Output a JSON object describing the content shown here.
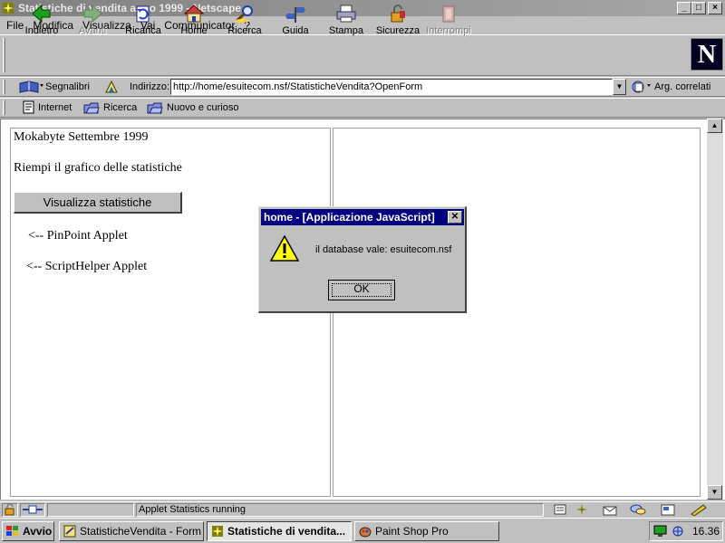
{
  "window": {
    "title": "Statistiche di vendita anno 1999 - Netscape",
    "min": "_",
    "max": "□",
    "close": "×"
  },
  "menu": [
    "File",
    "Modifica",
    "Visualizza",
    "Vai",
    "Communicator",
    "?"
  ],
  "toolbar": {
    "buttons": [
      {
        "label": "Indietro",
        "icon": "back-arrow-icon",
        "enabled": true
      },
      {
        "label": "Avanti",
        "icon": "forward-arrow-icon",
        "enabled": false
      },
      {
        "label": "Ricarica",
        "icon": "reload-icon",
        "enabled": true
      },
      {
        "label": "Home",
        "icon": "home-icon",
        "enabled": true
      },
      {
        "label": "Ricerca",
        "icon": "search-icon",
        "enabled": true
      },
      {
        "label": "Guida",
        "icon": "guide-icon",
        "enabled": true
      },
      {
        "label": "Stampa",
        "icon": "printer-icon",
        "enabled": true
      },
      {
        "label": "Sicurezza",
        "icon": "padlock-icon",
        "enabled": true
      },
      {
        "label": "Interrompi",
        "icon": "stop-icon",
        "enabled": false
      }
    ],
    "logo": "N"
  },
  "location": {
    "bookmarks_label": "Segnalibri",
    "address_label": "Indirizzo:",
    "url": "http://home/esuitecom.nsf/StatisticheVendita?OpenForm",
    "related_label": "Arg. correlati"
  },
  "personal": [
    "Internet",
    "Ricerca",
    "Nuovo e curioso"
  ],
  "page": {
    "heading": "Mokabyte Settembre 1999",
    "instruction": "Riempi il grafico delle statistiche",
    "button": "Visualizza statistiche",
    "pinpoint": "<-- PinPoint Applet",
    "scripthelper": "<-- ScriptHelper Applet"
  },
  "dialog": {
    "title": "home - [Applicazione JavaScript]",
    "message": "il database vale: esuitecom.nsf",
    "ok": "OK"
  },
  "status": {
    "text": "Applet Statistics running"
  },
  "taskbar": {
    "start": "Avvio",
    "tasks": [
      {
        "label": "StatisticheVendita - Form - ...",
        "icon": "notes-icon",
        "active": false
      },
      {
        "label": "Statistiche di vendita...",
        "icon": "netscape-icon",
        "active": true
      },
      {
        "label": "Paint Shop Pro",
        "icon": "paintshop-icon",
        "active": false
      }
    ],
    "clock": "16.36"
  },
  "colors": {
    "dialog_title": "#000080",
    "desktop": "#c0c0c0",
    "warning": "#ffff00"
  }
}
